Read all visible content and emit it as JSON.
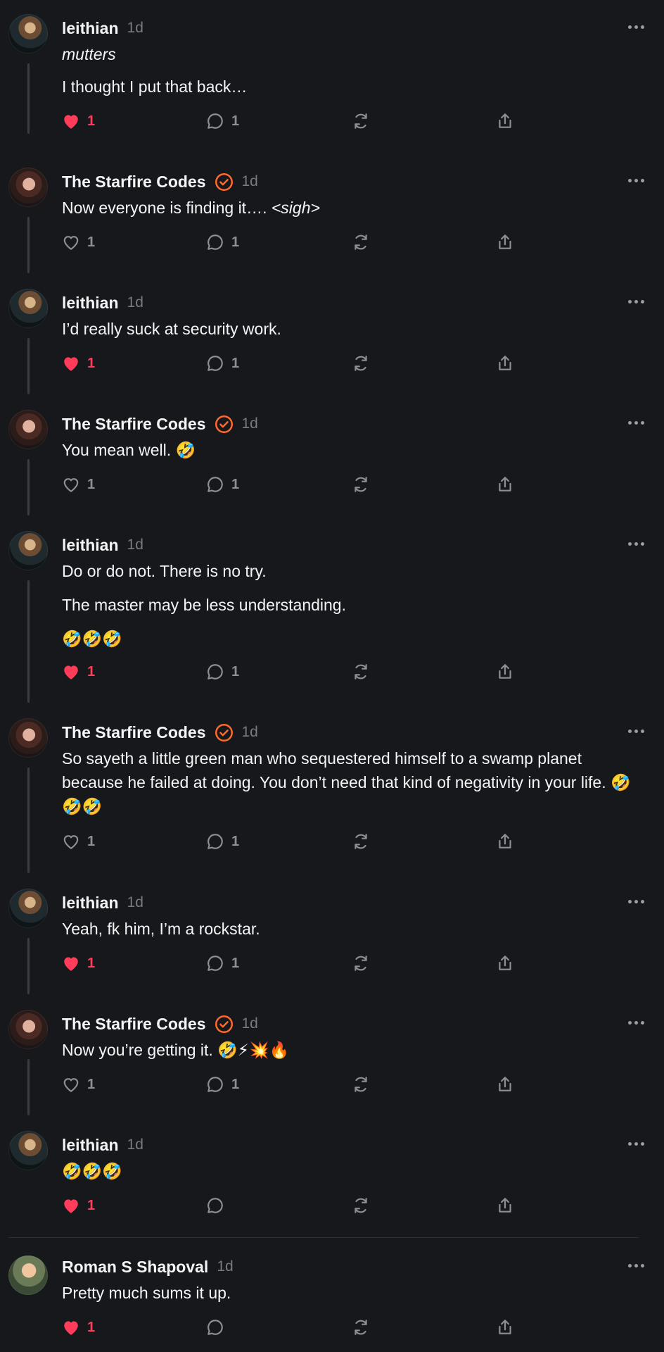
{
  "posts": [
    {
      "author": "leithian",
      "avatar": "leithian-avatar",
      "time": "1d",
      "verified": false,
      "paragraphs": [
        "mutters",
        "I thought I put that back…"
      ],
      "italic_first": true,
      "likes": "1",
      "liked": true,
      "replies": "1"
    },
    {
      "author": "The Starfire Codes",
      "avatar": "starfire-avatar",
      "time": "1d",
      "verified": true,
      "text_plain": "Now everyone is finding it…. ",
      "text_italic": "<sigh>",
      "likes": "1",
      "liked": false,
      "replies": "1"
    },
    {
      "author": "leithian",
      "avatar": "leithian-avatar",
      "time": "1d",
      "verified": false,
      "paragraphs": [
        "I’d really suck at security work."
      ],
      "likes": "1",
      "liked": true,
      "replies": "1"
    },
    {
      "author": "The Starfire Codes",
      "avatar": "starfire-avatar",
      "time": "1d",
      "verified": true,
      "paragraphs": [
        "You mean well. 🤣"
      ],
      "likes": "1",
      "liked": false,
      "replies": "1"
    },
    {
      "author": "leithian",
      "avatar": "leithian-avatar",
      "time": "1d",
      "verified": false,
      "paragraphs": [
        "Do or do not. There is no try.",
        "The master may be less understanding.",
        "🤣🤣🤣"
      ],
      "likes": "1",
      "liked": true,
      "replies": "1"
    },
    {
      "author": "The Starfire Codes",
      "avatar": "starfire-avatar",
      "time": "1d",
      "verified": true,
      "paragraphs": [
        "So sayeth a little green man who sequestered himself to a swamp planet because he failed at doing. You don’t need that kind of negativity in your life. 🤣🤣🤣"
      ],
      "likes": "1",
      "liked": false,
      "replies": "1"
    },
    {
      "author": "leithian",
      "avatar": "leithian-avatar",
      "time": "1d",
      "verified": false,
      "paragraphs": [
        "Yeah, fk him, I’m a rockstar."
      ],
      "likes": "1",
      "liked": true,
      "replies": "1"
    },
    {
      "author": "The Starfire Codes",
      "avatar": "starfire-avatar",
      "time": "1d",
      "verified": true,
      "paragraphs": [
        "Now you’re getting it. 🤣⚡💥🔥"
      ],
      "likes": "1",
      "liked": false,
      "replies": "1"
    },
    {
      "author": "leithian",
      "avatar": "leithian-avatar",
      "time": "1d",
      "verified": false,
      "paragraphs": [
        "🤣🤣🤣"
      ],
      "likes": "1",
      "liked": true,
      "replies": ""
    },
    {
      "author": "Roman S Shapoval",
      "avatar": "roman-avatar",
      "time": "1d",
      "verified": false,
      "paragraphs": [
        "Pretty much sums it up."
      ],
      "likes": "1",
      "liked": true,
      "replies": ""
    }
  ],
  "icons": {
    "like": "heart-icon",
    "reply": "comment-icon",
    "repost": "repost-icon",
    "share": "share-icon",
    "more": "more-options-icon",
    "verified": "verified-badge-icon"
  },
  "colors": {
    "background": "#16181b",
    "liked": "#ff3d5a",
    "verified": "#ff6a2a",
    "muted": "#777c82"
  }
}
